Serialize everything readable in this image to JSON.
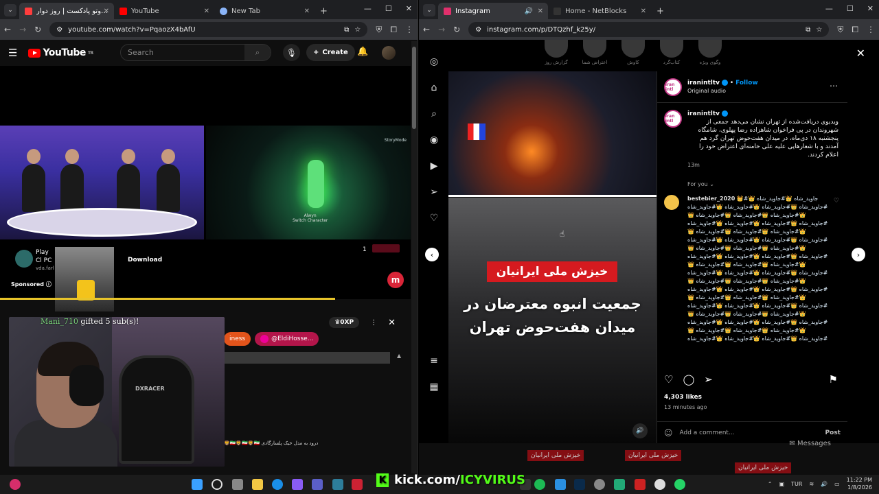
{
  "left_window": {
    "tabs": [
      {
        "title": "من‌وتو پادکست | روز دوار",
        "color": "#ff3d3d",
        "active": true
      },
      {
        "title": "YouTube",
        "color": "#ff0000",
        "active": false
      },
      {
        "title": "New Tab",
        "color": "#8ab4f8",
        "active": false
      }
    ],
    "url": "youtube.com/watch?v=PqaozX4bAfU",
    "youtube": {
      "logo": "YouTube",
      "logo_sup": "TR",
      "search_placeholder": "Search",
      "create_label": "Create",
      "ad": {
        "title": "Play Cl PC",
        "url": "vda.farl",
        "download": "Download",
        "sponsored": "Sponsored",
        "counter": "1"
      },
      "game": {
        "tag": "StoryMode",
        "caption_name": "Alwyn",
        "caption_line": "Switch Character"
      },
      "chat": {
        "gift_user": "Mani_710",
        "gift_text": " gifted 5 sub(s)!",
        "xp": "0XP",
        "chip1": "iness",
        "chip2": "@EldiHosse...",
        "message": "درود به مدل خیک پلسارگادی"
      },
      "stream_chair_brand": "DXRACER"
    },
    "overlay_brand": "kick.com/",
    "overlay_user": "ICYVIRUS"
  },
  "right_window": {
    "tabs": [
      {
        "title": "Instagram",
        "color": "#e1306c",
        "active": true
      },
      {
        "title": "Home - NetBlocks",
        "color": "#333333",
        "active": false
      }
    ],
    "url": "instagram.com/p/DTQzhf_k25y/",
    "stories": [
      "گزارش روز",
      "اعتراض شما",
      "کاوش",
      "کتاب‌گرد",
      "وگوی ویژه"
    ],
    "post": {
      "username": "iranintltv",
      "follow": "Follow",
      "audio": "Original audio",
      "avatar_text": "iran intl",
      "caption": "ویدیوی دریافت‌شده از تهران نشان می‌دهد جمعی از شهروندان در پی فراخوان شاهزاده رضا پهلوی، شامگاه پنجشنبه ۱۸ دی‌ماه، در میدان هفت‌حوض تهران گرد هم آمدند و با شعارهایی علیه علی خامنه‌ای اعتراض خود را اعلام کردند.",
      "caption_time": "13m",
      "for_you": "For you",
      "commenter": "bestebier_2020",
      "comment_text": "👑#جاوید_شاه 👑#جاوید_شاه 👑#جاوید_شاه 👑#جاوید_شاه 👑#جاوید_شاه 👑#جاوید_شاه 👑#جاوید_شاه 👑#جاوید_شاه 👑#جاوید_شاه 👑#جاوید_شاه 👑#جاوید_شاه 👑#جاوید_شاه 👑#جاوید_شاه 👑#جاوید_شاه 👑#جاوید_شاه 👑#جاوید_شاه 👑#جاوید_شاه 👑#جاوید_شاه 👑#جاوید_شاه 👑#جاوید_شاه 👑#جاوید_شاه 👑#جاوید_شاه 👑#جاوید_شاه 👑#جاوید_شاه 👑#جاوید_شاه 👑#جاوید_شاه 👑#جاوید_شاه 👑#جاوید_شاه 👑#جاوید_شاه 👑#جاوید_شاه 👑#جاوید_شاه 👑#جاوید_شاه 👑#جاوید_شاه 👑#جاوید_شاه 👑#جاوید_شاه 👑#جاوید_شاه 👑#جاوید_شاه 👑#جاوید_شاه 👑#جاوید_شاه 👑#جاوید_شاه 👑#جاوید_شاه 👑#جاوید_شاه 👑#جاوید_شاه 👑#جاوید_شاه 👑#جاوید_شاه 👑#جاوید_شاه 👑#جاوید_شاه 👑#جاوید_شاه 👑#جاوید_شاه 👑#جاوید_شاه 👑#جاوید_شاه 👑#جاوید_شاه 👑#جاوید_شاه 👑#جاوید_شاه 👑#جاوید_شاه 👑#جاوید_شاه 👑#جاوید_شاه 👑#جاوید_شاه 👑#جاوید_شاه 👑#جاوید_شاه 👑#جاوید_شاه 👑#جاوید_شاه",
      "likes": "4,303 likes",
      "ago": "13 minutes ago",
      "add_comment": "Add a comment...",
      "post_btn": "Post",
      "overlay_red": "خیزش ملی ایرانیان",
      "overlay_big": "جمعیت انبوه معترضان در میدان هفت‌حوض تهران"
    },
    "footer_tags": [
      "خیزش ملی ایرانیان",
      "خیزش ملی ایرانیان",
      "خیزش ملی ایرانیان"
    ],
    "messages": "Messages"
  },
  "taskbar": {
    "lang": "TUR",
    "time": "11:22 PM",
    "date": "1/8/2026"
  },
  "colors": {
    "yt_red": "#ff0000",
    "ig_blue": "#0095f6",
    "kick_green": "#53fc18",
    "protest_red": "#d51a1f"
  }
}
